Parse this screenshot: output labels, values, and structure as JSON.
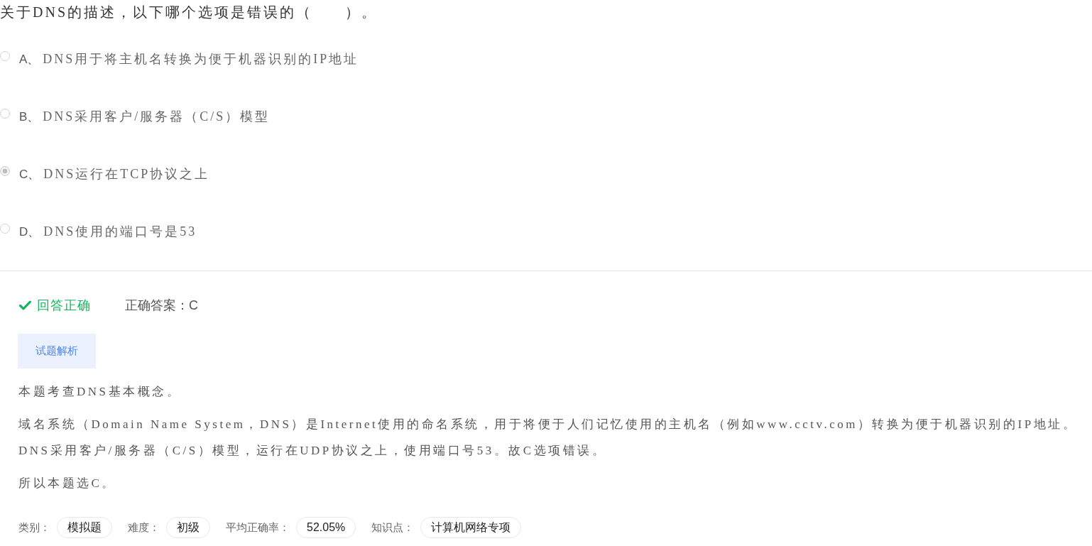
{
  "question": {
    "text": "关于DNS的描述，以下哪个选项是错误的（　　）。"
  },
  "options": [
    {
      "letter": "A、",
      "text": "DNS用于将主机名转换为便于机器识别的IP地址",
      "selected": false
    },
    {
      "letter": "B、",
      "text": "DNS采用客户/服务器（C/S）模型",
      "selected": false
    },
    {
      "letter": "C、",
      "text": "DNS运行在TCP协议之上",
      "selected": true
    },
    {
      "letter": "D、",
      "text": "DNS使用的端口号是53",
      "selected": false
    }
  ],
  "result": {
    "correct": true,
    "status": "回答正确",
    "answer": "正确答案：C"
  },
  "analysis": {
    "button": "试题解析",
    "paragraphs": [
      "本题考查DNS基本概念。",
      "域名系统（Domain Name System，DNS）是Internet使用的命名系统，用于将便于人们记忆使用的主机名（例如www.cctv.com）转换为便于机器识别的IP地址。DNS采用客户/服务器（C/S）模型，运行在UDP协议之上，使用端口号53。故C选项错误。",
      "所以本题选C。"
    ]
  },
  "meta": [
    {
      "label": "类别：",
      "value": "模拟题"
    },
    {
      "label": "难度：",
      "value": "初级"
    },
    {
      "label": "平均正确率：",
      "value": "52.05%"
    },
    {
      "label": "知识点：",
      "value": "计算机网络专项"
    }
  ]
}
